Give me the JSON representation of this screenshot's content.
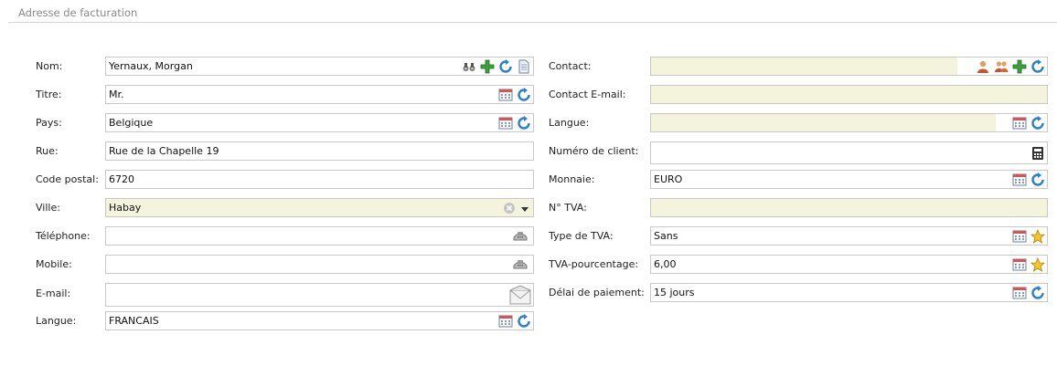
{
  "section": {
    "title": "Adresse de facturation"
  },
  "left": {
    "nom": {
      "label": "Nom:",
      "value": "Yernaux, Morgan"
    },
    "titre": {
      "label": "Titre:",
      "value": "Mr."
    },
    "pays": {
      "label": "Pays:",
      "value": "Belgique"
    },
    "rue": {
      "label": "Rue:",
      "value": "Rue de la Chapelle 19"
    },
    "code_postal": {
      "label": "Code postal:",
      "value": "6720"
    },
    "ville": {
      "label": "Ville:",
      "value": "Habay"
    },
    "telephone": {
      "label": "Téléphone:",
      "value": ""
    },
    "mobile": {
      "label": "Mobile:",
      "value": ""
    },
    "email": {
      "label": "E-mail:",
      "value": ""
    },
    "langue": {
      "label": "Langue:",
      "value": "FRANCAIS"
    }
  },
  "right": {
    "contact": {
      "label": "Contact:",
      "value": ""
    },
    "contact_email": {
      "label": "Contact E-mail:",
      "value": ""
    },
    "langue": {
      "label": "Langue:",
      "value": ""
    },
    "numero_client": {
      "label": "Numéro de client:",
      "value": ""
    },
    "monnaie": {
      "label": "Monnaie:",
      "value": "EURO"
    },
    "tva": {
      "label": "N° TVA:",
      "value": ""
    },
    "type_tva": {
      "label": "Type de TVA:",
      "value": "Sans"
    },
    "tva_pourcentage": {
      "label": "TVA-pourcentage:",
      "value": "6,00"
    },
    "delai_paiement": {
      "label": "Délai de paiement:",
      "value": "15 jours"
    }
  },
  "colors": {
    "yellow_field": "#f4f4dc",
    "border": "#c8c8c8",
    "icon_blue": "#2a7fd4",
    "icon_green": "#3aa23a"
  }
}
